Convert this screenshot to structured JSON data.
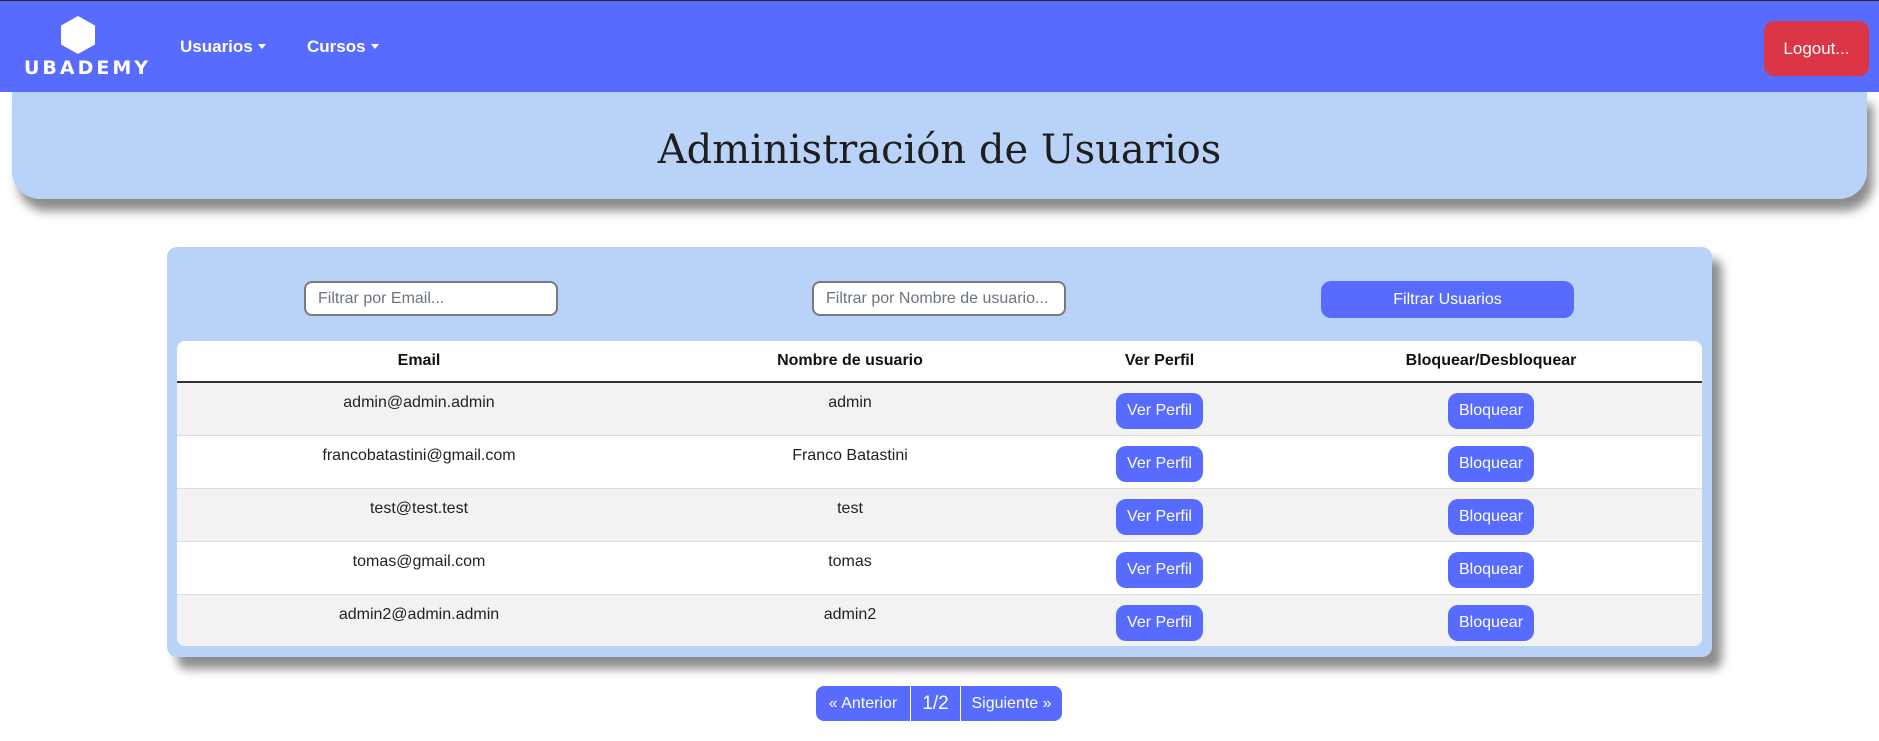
{
  "navbar": {
    "brand": "UBADEMY",
    "menus": [
      {
        "label": "Usuarios"
      },
      {
        "label": "Cursos"
      }
    ],
    "logout_label": "Logout..."
  },
  "header": {
    "title": "Administración de Usuarios"
  },
  "filters": {
    "email_placeholder": "Filtrar por Email...",
    "username_placeholder": "Filtrar por Nombre de usuario...",
    "submit_label": "Filtrar Usuarios"
  },
  "table": {
    "columns": [
      "Email",
      "Nombre de usuario",
      "Ver Perfil",
      "Bloquear/Desbloquear"
    ],
    "view_label": "Ver Perfil",
    "block_label": "Bloquear",
    "rows": [
      {
        "email": "admin@admin.admin",
        "username": "admin"
      },
      {
        "email": "francobatastini@gmail.com",
        "username": "Franco Batastini"
      },
      {
        "email": "test@test.test",
        "username": "test"
      },
      {
        "email": "tomas@gmail.com",
        "username": "tomas"
      },
      {
        "email": "admin2@admin.admin",
        "username": "admin2"
      }
    ]
  },
  "pagination": {
    "prev_label": "« Anterior",
    "current": "1/2",
    "next_label": "Siguiente »"
  },
  "colors": {
    "primary": "#576bff",
    "banner": "#b9d3f8",
    "danger": "#dc3545"
  }
}
